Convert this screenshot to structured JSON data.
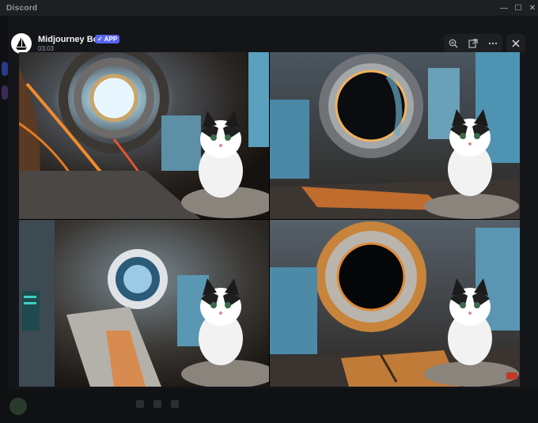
{
  "window": {
    "app_title": "Discord",
    "controls": {
      "minimize": "—",
      "maximize": "☐",
      "close": "✕"
    }
  },
  "message": {
    "username": "Midjourney Bot",
    "badge": "APP",
    "timestamp": "03:03",
    "avatar_icon": "midjourney-sailboat-icon"
  },
  "toolbar": {
    "zoom_icon": "zoom-in-icon",
    "open_icon": "open-in-browser-icon",
    "more_icon": "more-options-icon",
    "close_icon": "close-icon"
  },
  "images": [
    {
      "label": "space-station-tunnel-kitten"
    },
    {
      "label": "porthole-station-kitten"
    },
    {
      "label": "corridor-window-kitten"
    },
    {
      "label": "orange-porthole-kitten"
    }
  ],
  "colors": {
    "accent": "#5865f2",
    "titlebar": "#1e1f22",
    "backdrop": "#0b0c0e"
  }
}
